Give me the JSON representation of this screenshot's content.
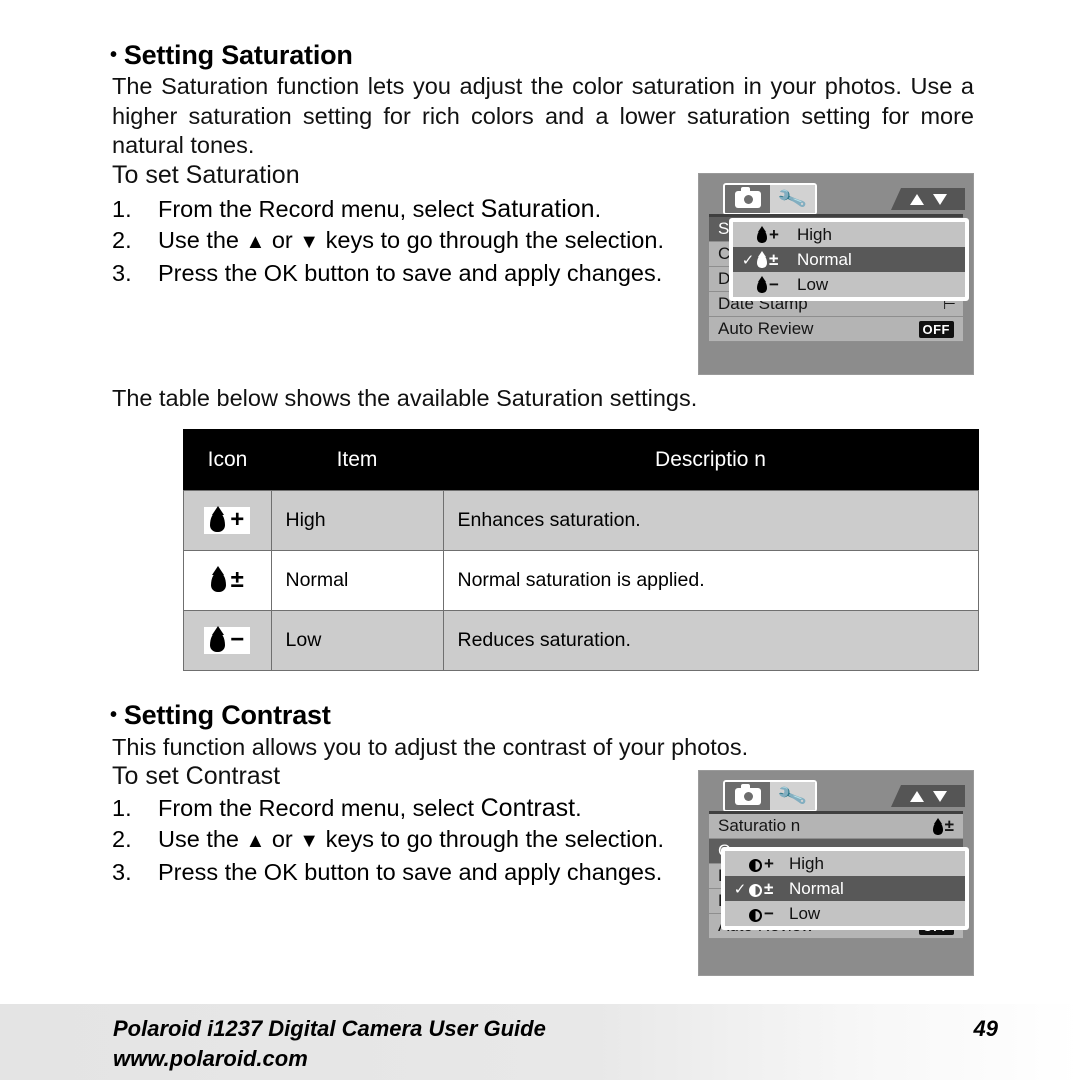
{
  "saturation_section": {
    "heading": "Setting Saturation",
    "bullet": "•",
    "intro": "The Saturation function lets you adjust the color saturation in your photos. Use a higher saturation setting for rich colors and a lower saturation setting for more natural tones.",
    "subhead": "To set Saturation",
    "steps": [
      {
        "num": "1.",
        "pre": "From the Record menu, select ",
        "emphasis": "Saturation",
        "post": "."
      },
      {
        "num": "2.",
        "pre": "Use the ",
        "emphasis": "",
        "post": " keys to go through the selection.",
        "up": "▲",
        "or": " or ",
        "down": "▼"
      },
      {
        "num": "3.",
        "pre": "Press the OK button to save and apply changes.",
        "emphasis": "",
        "post": ""
      }
    ],
    "table_intro": "The table below shows the available Saturation settings."
  },
  "settings_table": {
    "headers": [
      "Icon",
      "Item",
      "Descriptio  n"
    ],
    "rows": [
      {
        "icon_sign": "+",
        "icon_kind": "droplet",
        "item": "High",
        "description": "Enhances saturation."
      },
      {
        "icon_sign": "±",
        "icon_kind": "droplet",
        "item": "Normal",
        "description": "Normal saturation is applied."
      },
      {
        "icon_sign": "−",
        "icon_kind": "droplet",
        "item": "Low",
        "description": "Reduces saturation."
      }
    ]
  },
  "contrast_section": {
    "heading": "Setting Contrast",
    "bullet": "•",
    "intro": "This function allows you to adjust the contrast of your photos.",
    "subhead": "To set Contrast",
    "steps": [
      {
        "num": "1.",
        "pre": "From the Record menu, select ",
        "emphasis": "Contrast",
        "post": "."
      },
      {
        "num": "2.",
        "pre": "Use the ",
        "post": " keys to go through the selection.",
        "up": "▲",
        "or": " or ",
        "down": "▼"
      },
      {
        "num": "3.",
        "pre": "Press the OK button to save and apply changes.",
        "post": ""
      }
    ]
  },
  "lcd_saturation": {
    "tabs": [
      {
        "icon": "camera-icon",
        "state": "active"
      },
      {
        "icon": "wrench-screwdriver-icon",
        "state": "inactive"
      }
    ],
    "scroll_indicator": {
      "up": "▲",
      "down": "▼"
    },
    "rows": [
      {
        "label": "S",
        "value": "",
        "selected": true
      },
      {
        "label": "C",
        "value": "",
        "selected": false
      },
      {
        "label": "D",
        "value": "",
        "selected": false
      },
      {
        "label": "Date Stamp",
        "value": "date-stamp-icon",
        "selected": false
      },
      {
        "label": "Auto Review",
        "value": "OFF",
        "selected": false
      }
    ],
    "popup": {
      "options": [
        {
          "check": "",
          "icon": "droplet",
          "sign": "+",
          "label": "High",
          "selected": false
        },
        {
          "check": "✓",
          "icon": "droplet",
          "sign": "±",
          "label": "Normal",
          "selected": true
        },
        {
          "check": "",
          "icon": "droplet",
          "sign": "−",
          "label": "Low",
          "selected": false
        }
      ]
    }
  },
  "lcd_contrast": {
    "tabs": [
      {
        "icon": "camera-icon",
        "state": "active"
      },
      {
        "icon": "wrench-screwdriver-icon",
        "state": "inactive"
      }
    ],
    "scroll_indicator": {
      "up": "▲",
      "down": "▼"
    },
    "rows": [
      {
        "label": "Saturatio  n",
        "value": "droplet±",
        "selected": false
      },
      {
        "label": "C",
        "value": "",
        "selected": true
      },
      {
        "label": "D",
        "value": "",
        "selected": false
      },
      {
        "label": "D",
        "value": "",
        "selected": false
      },
      {
        "label": "Auto Review",
        "value": "OFF",
        "selected": false
      }
    ],
    "popup": {
      "options": [
        {
          "check": "",
          "icon": "contrast",
          "sign": "+",
          "label": "High",
          "selected": false
        },
        {
          "check": "✓",
          "icon": "contrast",
          "sign": "±",
          "label": "Normal",
          "selected": true
        },
        {
          "check": "",
          "icon": "contrast",
          "sign": "−",
          "label": "Low",
          "selected": false
        }
      ]
    }
  },
  "footer": {
    "title": "Polaroid i1237 Digital Camera User Guide",
    "url": "www.polaroid.com",
    "page": "49"
  }
}
